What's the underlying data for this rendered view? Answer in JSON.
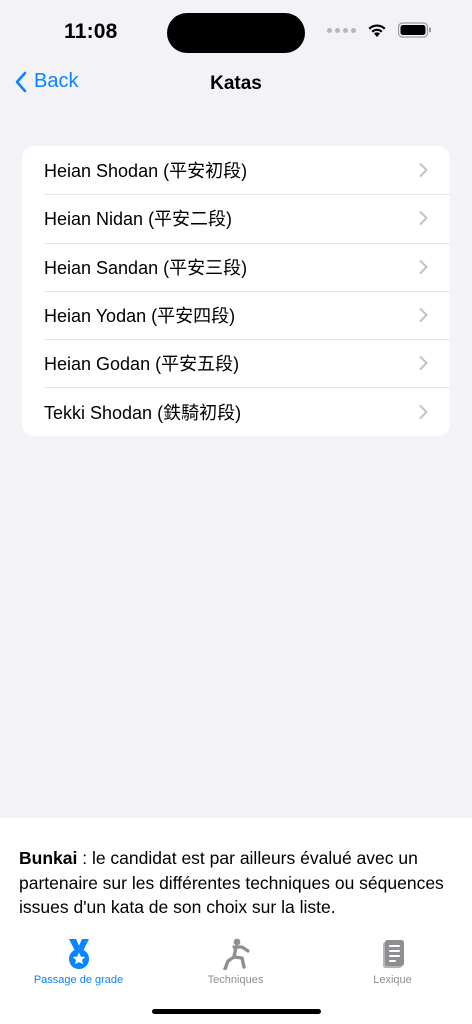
{
  "status_bar": {
    "time": "11:08"
  },
  "nav": {
    "back_label": "Back",
    "title": "Katas"
  },
  "katas": [
    {
      "label": "Heian Shodan (平安初段)"
    },
    {
      "label": "Heian Nidan (平安二段)"
    },
    {
      "label": "Heian Sandan (平安三段)"
    },
    {
      "label": "Heian Yodan (平安四段)"
    },
    {
      "label": "Heian Godan (平安五段)"
    },
    {
      "label": "Tekki Shodan (鉄騎初段)"
    }
  ],
  "info": {
    "bold_term": "Bunkai",
    "text": " : le candidat est par ailleurs évalué avec un partenaire sur les différentes techniques ou séquences issues d'un kata de son choix sur la liste."
  },
  "tabs": [
    {
      "label": "Passage de grade",
      "icon": "medal-icon",
      "active": true
    },
    {
      "label": "Techniques",
      "icon": "figure-kick-icon",
      "active": false
    },
    {
      "label": "Lexique",
      "icon": "book-icon",
      "active": false
    }
  ],
  "colors": {
    "accent": "#0a84ff",
    "inactive": "#8e8e93",
    "background": "#f2f2f7"
  }
}
